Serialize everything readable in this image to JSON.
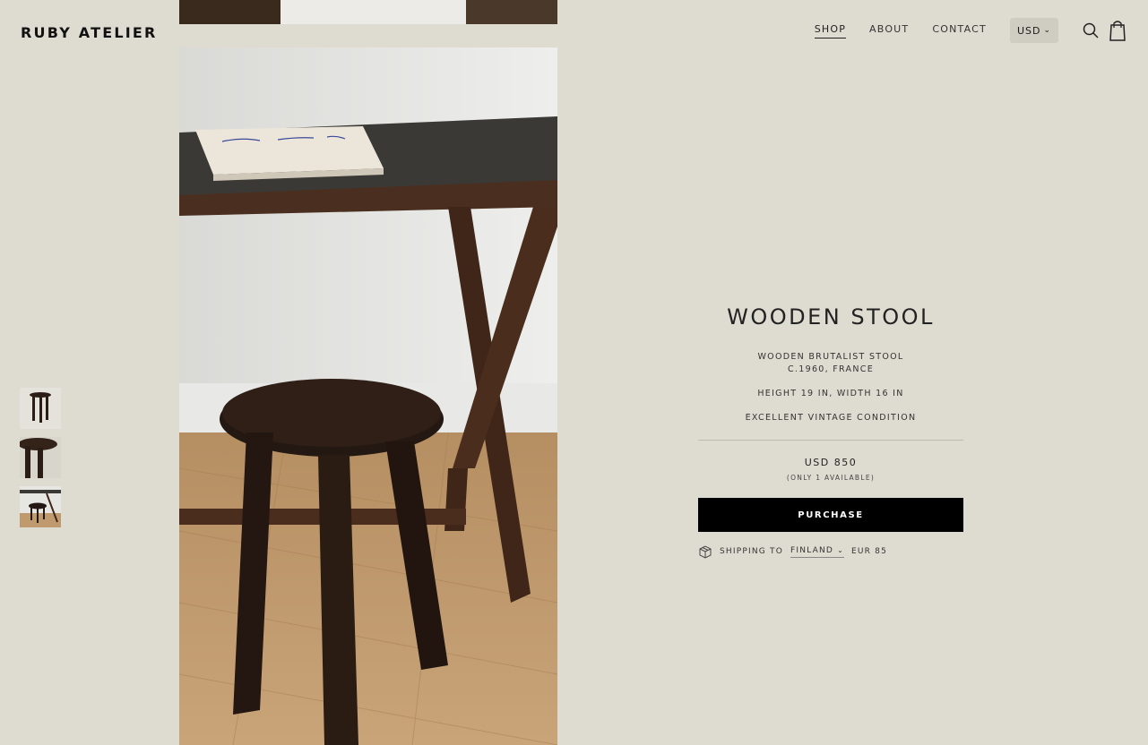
{
  "brand": {
    "logo": "RUBY ATELIER"
  },
  "nav": {
    "items": [
      {
        "label": "SHOP",
        "active": true
      },
      {
        "label": "ABOUT",
        "active": false
      },
      {
        "label": "CONTACT",
        "active": false
      }
    ],
    "currency": "USD",
    "icons": [
      "search-icon",
      "shopping-bag-icon",
      "chevron-down-icon"
    ]
  },
  "product": {
    "title": "WOODEN STOOL",
    "description": {
      "line1": "WOODEN BRUTALIST STOOL",
      "line2": "C.1960, FRANCE",
      "dimensions": "HEIGHT 19 IN, WIDTH 16 IN",
      "condition": "EXCELLENT VINTAGE CONDITION"
    },
    "price": "USD 850",
    "availability": "(ONLY 1 AVAILABLE)",
    "purchase_label": "PURCHASE",
    "shipping": {
      "label": "SHIPPING TO",
      "country": "FINLAND",
      "cost": "EUR 85"
    }
  },
  "colors": {
    "background": "#dedcd0",
    "button": "#000000",
    "button_text": "#ffffff",
    "text": "#1a1a1a"
  }
}
